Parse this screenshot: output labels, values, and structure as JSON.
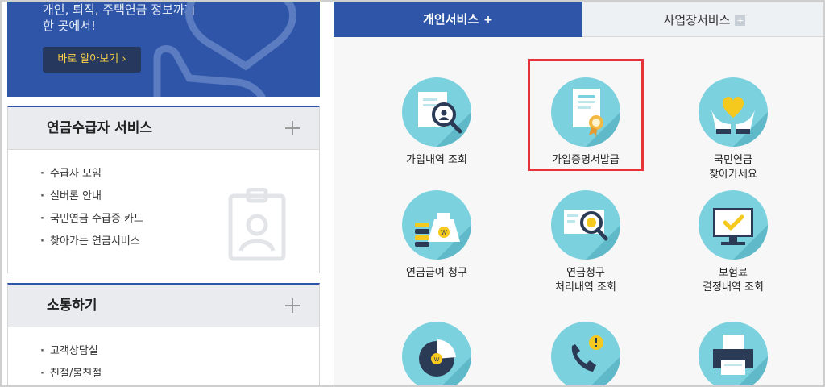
{
  "banner": {
    "line1": "개인, 퇴직, 주택연금 정보까지",
    "line2": "한 곳에서!",
    "button_label": "바로 알아보기 ›"
  },
  "sections": [
    {
      "title": "연금수급자 서비스",
      "items": [
        "수급자 모임",
        "실버론 안내",
        "국민연금 수급증 카드",
        "찾아가는 연금서비스"
      ]
    },
    {
      "title": "소통하기",
      "items": [
        "고객상담실",
        "친절/불친절"
      ]
    }
  ],
  "tabs": {
    "personal": {
      "label": "개인서비스",
      "symbol": "+"
    },
    "business": {
      "label": "사업장서비스",
      "symbol": "+"
    }
  },
  "services": [
    {
      "label": "가입내역 조회",
      "icon": "document-search-icon"
    },
    {
      "label": "가입증명서발급",
      "icon": "certificate-icon"
    },
    {
      "label": "국민연금\n찾아가세요",
      "icon": "heart-hands-icon"
    },
    {
      "label": "연금급여 청구",
      "icon": "money-bag-icon"
    },
    {
      "label": "연금청구\n처리내역 조회",
      "icon": "ticket-search-icon"
    },
    {
      "label": "보험료\n결정내역 조회",
      "icon": "monitor-check-icon"
    },
    {
      "label": "",
      "icon": "pie-chart-icon"
    },
    {
      "label": "",
      "icon": "phone-alert-icon"
    },
    {
      "label": "",
      "icon": "printer-icon"
    }
  ],
  "colors": {
    "brand_blue": "#2e55a8",
    "icon_circle": "#7cd1df",
    "highlight_red": "#e8323a",
    "accent_yellow": "#ffd24a"
  }
}
